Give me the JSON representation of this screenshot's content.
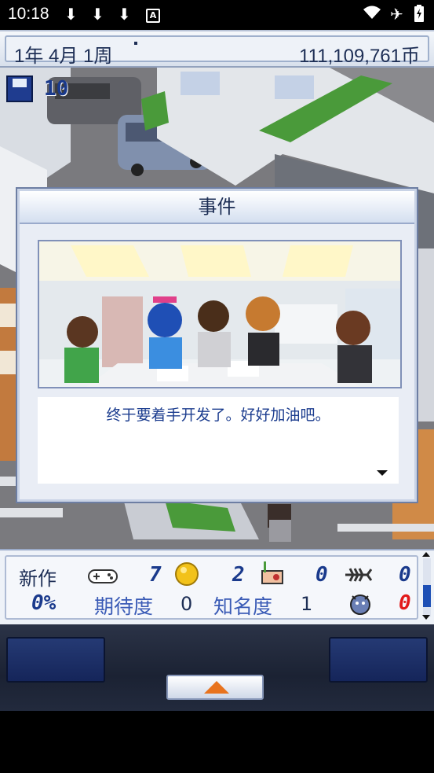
{
  "status_bar": {
    "time": "10:18"
  },
  "top_bar": {
    "date": "1年 4月 1周",
    "money": "111,109,761币"
  },
  "save": {
    "count": "10"
  },
  "dialog": {
    "title": "事件",
    "message": "终于要着手开发了。好好加油吧。"
  },
  "stats": {
    "new_label": "新作",
    "progress": "0%",
    "games_value": "7",
    "coins_value": "2",
    "research_value": "0",
    "fish_value": "0",
    "bug_value": "0",
    "expectation_label": "期待度",
    "expectation_value": "0",
    "fame_label": "知名度",
    "fame_value": "1"
  }
}
